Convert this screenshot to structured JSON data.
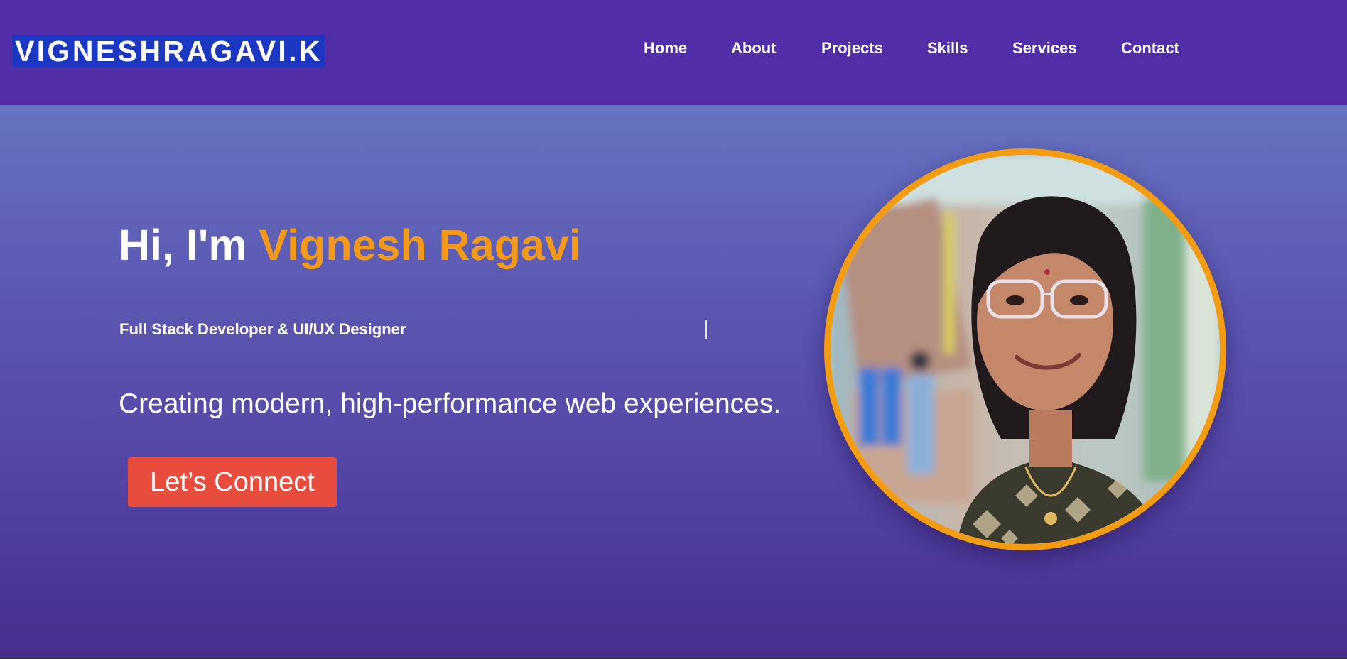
{
  "header": {
    "logo": "VIGNESHRAGAVI.K",
    "nav": [
      "Home",
      "About",
      "Projects",
      "Skills",
      "Services",
      "Contact"
    ]
  },
  "hero": {
    "greeting_prefix": "Hi, I'm ",
    "greeting_name": "Vignesh Ragavi",
    "role": "Full Stack Developer & UI/UX Designer",
    "tagline": "Creating modern, high-performance web experiences.",
    "cta_label": "Let’s Connect"
  },
  "colors": {
    "nav_background": "#512da8",
    "accent_orange": "#f39c12",
    "cta_red": "#e74c3c",
    "logo_highlight": "#1c38c2"
  }
}
